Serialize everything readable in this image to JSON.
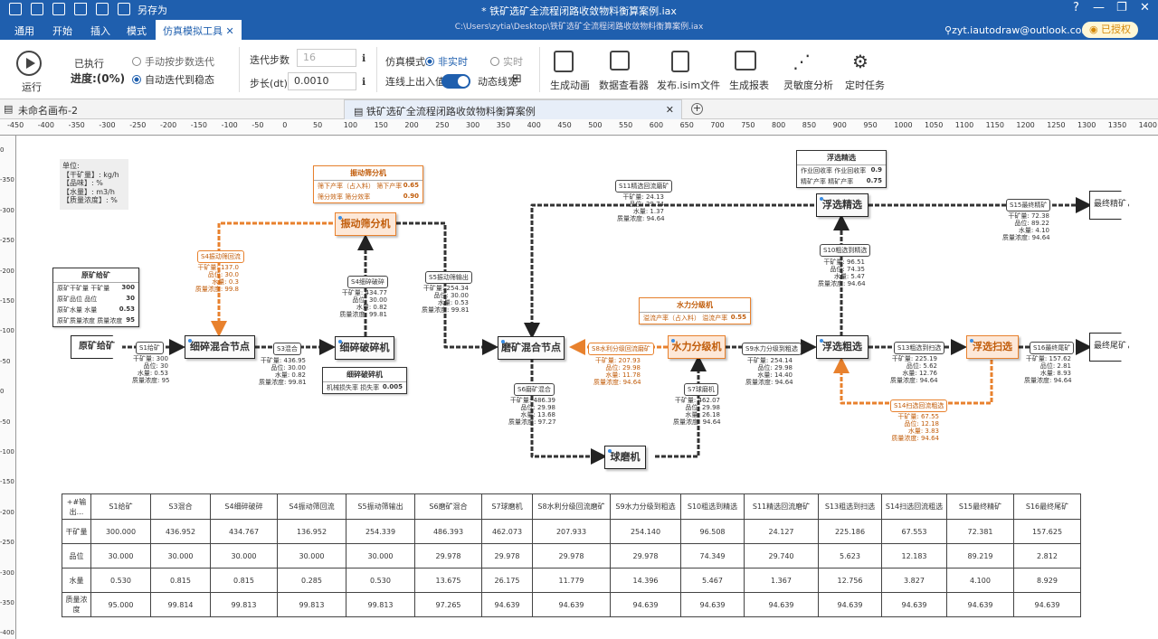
{
  "app": {
    "title": "*  铁矿选矿全流程闭路收敛物料衡算案例.iax",
    "path": "C:\\Users\\zytia\\Desktop\\铁矿选矿全流程闭路收敛物料衡算案例.iax",
    "save_as": "另存为",
    "user": "zyt.iautodraw@outlook.com",
    "license": "已授权"
  },
  "menu": {
    "tabs": [
      "通用",
      "开始",
      "插入",
      "模式",
      "仿真模拟工具"
    ]
  },
  "ribbon": {
    "run": "运行",
    "executed": "已执行",
    "progress": "进度:(0%)",
    "manual": "手动按步数迭代",
    "auto": "自动迭代到稳态",
    "iter_steps_label": "迭代步数",
    "iter_steps": "16",
    "step_label": "步长(dt)",
    "step_value": "0.0010",
    "sim_mode": "仿真模式:",
    "nonrealtime": "非实时",
    "realtime": "实时",
    "line_io": "连线上出入值:",
    "dynamic_line": "动态线宽",
    "tools": [
      "生成动画",
      "数据查看器",
      "发布.isim文件",
      "生成报表",
      "灵敏度分析",
      "定时任务"
    ]
  },
  "doctabs": {
    "tab1": "未命名画布-2",
    "tab2": "铁矿选矿全流程闭路收敛物料衡算案例"
  },
  "ruler": {
    "top": [
      "-450",
      "-400",
      "-350",
      "-300",
      "-250",
      "-200",
      "-150",
      "-100",
      "-50",
      "0",
      "50",
      "100",
      "150",
      "200",
      "250",
      "300",
      "350",
      "400",
      "450",
      "500",
      "550",
      "600",
      "650",
      "700",
      "750",
      "800",
      "850",
      "900",
      "950",
      "1000",
      "1050",
      "1100",
      "1150",
      "1200",
      "1250",
      "1300",
      "1350",
      "1400"
    ],
    "left": [
      "0",
      "-350",
      "-300",
      "-250",
      "-200",
      "-150",
      "-100",
      "-50",
      "0",
      "-50",
      "-100",
      "-150",
      "-200",
      "-250",
      "-300",
      "-350",
      "-400"
    ]
  },
  "units": [
    "单位:",
    "【干矿量】: kg/h",
    "【品味】: %",
    "【水量】: m3/h",
    "【质量浓度】: %"
  ],
  "nodes": {
    "feed": "原矿给矿",
    "mix1": "细碎混合节点",
    "crusher": "细碎破碎机",
    "screen": "振动筛分机",
    "mix2": "磨矿混合节点",
    "mill": "球磨机",
    "cyclone": "水力分级机",
    "rougher": "浮选粗选",
    "cleaner": "浮选精选",
    "scavenger": "浮选扫选",
    "conc": "最终精矿",
    "tail": "最终尾矿"
  },
  "streams": {
    "s1": {
      "label": "S1给矿",
      "v": [
        "干矿量: 300",
        "品位: 30",
        "水量: 0.53",
        "质量浓度: 95"
      ]
    },
    "s3": {
      "label": "S3混合",
      "v": [
        "干矿量: 436.95",
        "品位: 30.00",
        "水量: 0.82",
        "质量浓度: 99.81"
      ]
    },
    "s4": {
      "label": "S4细碎破碎",
      "v": [
        "干矿量: 434.77",
        "品位: 30.00",
        "水量: 0.82",
        "质量浓度: 99.81"
      ]
    },
    "s4r": {
      "label": "S4振动筛回流",
      "v": [
        "干矿量: 137.0",
        "品位: 30.0",
        "水量: 0.3",
        "质量浓度: 99.8"
      ]
    },
    "s5": {
      "label": "S5振动筛输出",
      "v": [
        "干矿量: 254.34",
        "品位: 30.00",
        "水量: 0.53",
        "质量浓度: 99.81"
      ]
    },
    "s6": {
      "label": "S6磨矿混合",
      "v": [
        "干矿量: 486.39",
        "品位: 29.98",
        "水量: 13.68",
        "质量浓度: 97.27"
      ]
    },
    "s7": {
      "label": "S7球磨机",
      "v": [
        "干矿量: 462.07",
        "品位: 29.98",
        "水量: 26.18",
        "质量浓度: 94.64"
      ]
    },
    "s8": {
      "label": "S8水利分级回流磨矿",
      "v": [
        "干矿量: 207.93",
        "品位: 29.98",
        "水量: 11.78",
        "质量浓度: 94.64"
      ]
    },
    "s9": {
      "label": "S9水力分级到粗选",
      "v": [
        "干矿量: 254.14",
        "品位: 29.98",
        "水量: 14.40",
        "质量浓度: 94.64"
      ]
    },
    "s10": {
      "label": "S10粗选到精选",
      "v": [
        "干矿量: 96.51",
        "品位: 74.35",
        "水量: 5.47",
        "质量浓度: 94.64"
      ]
    },
    "s11": {
      "label": "S11精选回流磨矿",
      "v": [
        "干矿量: 24.13",
        "品位: 29.74",
        "水量: 1.37",
        "质量浓度: 94.64"
      ]
    },
    "s13": {
      "label": "S13粗选到扫选",
      "v": [
        "干矿量: 225.19",
        "品位: 5.62",
        "水量: 12.76",
        "质量浓度: 94.64"
      ]
    },
    "s14": {
      "label": "S14扫选回流粗选",
      "v": [
        "干矿量: 67.55",
        "品位: 12.18",
        "水量: 3.83",
        "质量浓度: 94.64"
      ]
    },
    "s15": {
      "label": "S15最终精矿",
      "v": [
        "干矿量: 72.38",
        "品位: 89.22",
        "水量: 4.10",
        "质量浓度: 94.64"
      ]
    },
    "s16": {
      "label": "S16最终尾矿",
      "v": [
        "干矿量: 157.62",
        "品位: 2.81",
        "水量: 8.93",
        "质量浓度: 94.64"
      ]
    }
  },
  "panels": {
    "feed": {
      "title": "原矿给矿",
      "rows": [
        [
          "原矿干矿量 干矿量",
          "300"
        ],
        [
          "原矿品位 品位",
          "30"
        ],
        [
          "原矿水量 水量",
          "0.53"
        ],
        [
          "原矿质量浓度 质量浓度",
          "95"
        ]
      ]
    },
    "screen": {
      "title": "振动筛分机",
      "rows": [
        [
          "筛下产率（占入料） 筛下产率",
          "0.65"
        ],
        [
          "筛分效率 筛分效率",
          "0.90"
        ]
      ]
    },
    "crusher": {
      "title": "细碎破碎机",
      "rows": [
        [
          "机械损失率 损失率",
          "0.005"
        ]
      ]
    },
    "cyclone": {
      "title": "水力分级机",
      "rows": [
        [
          "溢流产率（占入料） 溢流产率",
          "0.55"
        ]
      ]
    },
    "cleaner": {
      "title": "浮选精选",
      "rows": [
        [
          "作业回收率 作业回收率",
          "0.9"
        ],
        [
          "精矿产率 精矿产率",
          "0.75"
        ]
      ]
    }
  },
  "table": {
    "headers": [
      "+#输出...",
      "S1给矿",
      "S3混合",
      "S4细碎破碎",
      "S4振动筛回流",
      "S5振动筛输出",
      "S6磨矿混合",
      "S7球磨机",
      "S8水利分级回流磨矿",
      "S9水力分级到粗选",
      "S10粗选到精选",
      "S11精选回流磨矿",
      "S13粗选到扫选",
      "S14扫选回流粗选",
      "S15最终精矿",
      "S16最终尾矿"
    ],
    "rows": [
      [
        "干矿量",
        "300.000",
        "436.952",
        "434.767",
        "136.952",
        "254.339",
        "486.393",
        "462.073",
        "207.933",
        "254.140",
        "96.508",
        "24.127",
        "225.186",
        "67.553",
        "72.381",
        "157.625"
      ],
      [
        "品位",
        "30.000",
        "30.000",
        "30.000",
        "30.000",
        "30.000",
        "29.978",
        "29.978",
        "29.978",
        "29.978",
        "74.349",
        "29.740",
        "5.623",
        "12.183",
        "89.219",
        "2.812"
      ],
      [
        "水量",
        "0.530",
        "0.815",
        "0.815",
        "0.285",
        "0.530",
        "13.675",
        "26.175",
        "11.779",
        "14.396",
        "5.467",
        "1.367",
        "12.756",
        "3.827",
        "4.100",
        "8.929"
      ],
      [
        "质量浓度",
        "95.000",
        "99.814",
        "99.813",
        "99.813",
        "99.813",
        "97.265",
        "94.639",
        "94.639",
        "94.639",
        "94.639",
        "94.639",
        "94.639",
        "94.639",
        "94.639",
        "94.639"
      ]
    ]
  }
}
